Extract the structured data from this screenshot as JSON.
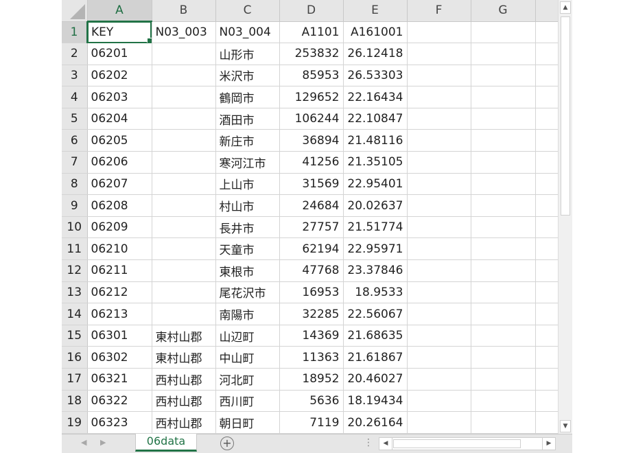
{
  "columns": [
    "A",
    "B",
    "C",
    "D",
    "E",
    "F",
    "G"
  ],
  "selected_column": "A",
  "active_cell": "A1",
  "rows": [
    {
      "num": "1",
      "key": "KEY",
      "b": "N03_003",
      "c": "N03_004",
      "d": "A1101",
      "e": "A161001"
    },
    {
      "num": "2",
      "key": "06201",
      "b": "",
      "c": "山形市",
      "d": "253832",
      "e": "26.12418"
    },
    {
      "num": "3",
      "key": "06202",
      "b": "",
      "c": "米沢市",
      "d": "85953",
      "e": "26.53303"
    },
    {
      "num": "4",
      "key": "06203",
      "b": "",
      "c": "鶴岡市",
      "d": "129652",
      "e": "22.16434"
    },
    {
      "num": "5",
      "key": "06204",
      "b": "",
      "c": "酒田市",
      "d": "106244",
      "e": "22.10847"
    },
    {
      "num": "6",
      "key": "06205",
      "b": "",
      "c": "新庄市",
      "d": "36894",
      "e": "21.48116"
    },
    {
      "num": "7",
      "key": "06206",
      "b": "",
      "c": "寒河江市",
      "d": "41256",
      "e": "21.35105"
    },
    {
      "num": "8",
      "key": "06207",
      "b": "",
      "c": "上山市",
      "d": "31569",
      "e": "22.95401"
    },
    {
      "num": "9",
      "key": "06208",
      "b": "",
      "c": "村山市",
      "d": "24684",
      "e": "20.02637"
    },
    {
      "num": "10",
      "key": "06209",
      "b": "",
      "c": "長井市",
      "d": "27757",
      "e": "21.51774"
    },
    {
      "num": "11",
      "key": "06210",
      "b": "",
      "c": "天童市",
      "d": "62194",
      "e": "22.95971"
    },
    {
      "num": "12",
      "key": "06211",
      "b": "",
      "c": "東根市",
      "d": "47768",
      "e": "23.37846"
    },
    {
      "num": "13",
      "key": "06212",
      "b": "",
      "c": "尾花沢市",
      "d": "16953",
      "e": "18.9533"
    },
    {
      "num": "14",
      "key": "06213",
      "b": "",
      "c": "南陽市",
      "d": "32285",
      "e": "22.56067"
    },
    {
      "num": "15",
      "key": "06301",
      "b": "東村山郡",
      "c": "山辺町",
      "d": "14369",
      "e": "21.68635"
    },
    {
      "num": "16",
      "key": "06302",
      "b": "東村山郡",
      "c": "中山町",
      "d": "11363",
      "e": "21.61867"
    },
    {
      "num": "17",
      "key": "06321",
      "b": "西村山郡",
      "c": "河北町",
      "d": "18952",
      "e": "20.46027"
    },
    {
      "num": "18",
      "key": "06322",
      "b": "西村山郡",
      "c": "西川町",
      "d": "5636",
      "e": "18.19434"
    },
    {
      "num": "19",
      "key": "06323",
      "b": "西村山郡",
      "c": "朝日町",
      "d": "7119",
      "e": "20.26164"
    }
  ],
  "sheet_tab": "06data",
  "icons": {
    "prev_sheet": "caret-left-icon",
    "next_sheet": "caret-right-icon",
    "add_sheet": "plus-circle-icon",
    "scroll_up": "arrow-up-icon",
    "scroll_down": "arrow-down-icon",
    "scroll_left": "arrow-left-icon",
    "scroll_right": "arrow-right-icon"
  },
  "colors": {
    "accent": "#217346",
    "header_bg": "#e6e6e6",
    "gridline": "#d4d4d4"
  }
}
